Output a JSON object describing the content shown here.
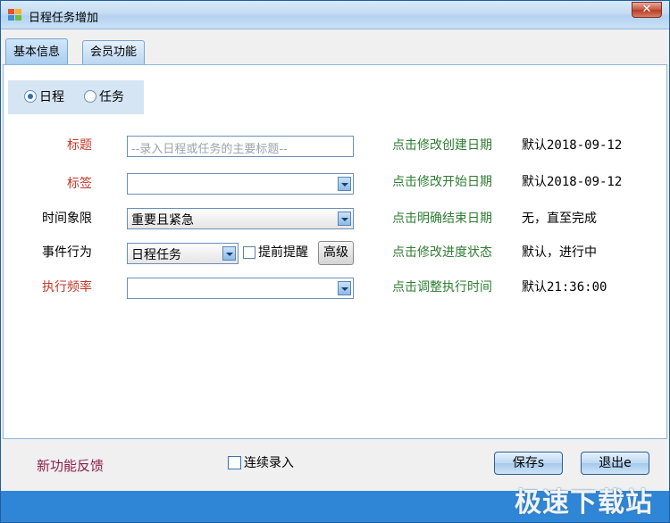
{
  "window": {
    "title": "日程任务增加",
    "close_label": "✕"
  },
  "tabs": [
    {
      "label": "基本信息",
      "active": true
    },
    {
      "label": "会员功能",
      "active": false
    }
  ],
  "type_radio": {
    "options": [
      "日程",
      "任务"
    ],
    "selected": "日程"
  },
  "form": {
    "title_label": "标题",
    "title_placeholder": "--录入日程或任务的主要标题--",
    "tag_label": "标签",
    "tag_value": "",
    "quadrant_label": "时间象限",
    "quadrant_value": "重要且紧急",
    "behavior_label": "事件行为",
    "behavior_value": "日程任务",
    "reminder_label": "提前提醒",
    "reminder_checked": false,
    "advanced_label": "高级",
    "frequency_label": "执行频率",
    "frequency_value": ""
  },
  "settings": [
    {
      "link": "点击修改创建日期",
      "value": "默认2018-09-12"
    },
    {
      "link": "点击修改开始日期",
      "value": "默认2018-09-12"
    },
    {
      "link": "点击明确结束日期",
      "value": "无，直至完成"
    },
    {
      "link": "点击修改进度状态",
      "value": "默认，进行中"
    },
    {
      "link": "点击调整执行时间",
      "value": "默认21:36:00"
    }
  ],
  "footer": {
    "feedback_label": "新功能反馈",
    "continuous_label": "连续录入",
    "continuous_checked": false,
    "save_label": "保存s",
    "exit_label": "退出e"
  },
  "watermark": "极速下载站",
  "colors": {
    "link_green": "#2e7d32",
    "required_red": "#c0392b",
    "feedback": "#8b1f48",
    "statusbar": "#2f86d6"
  }
}
